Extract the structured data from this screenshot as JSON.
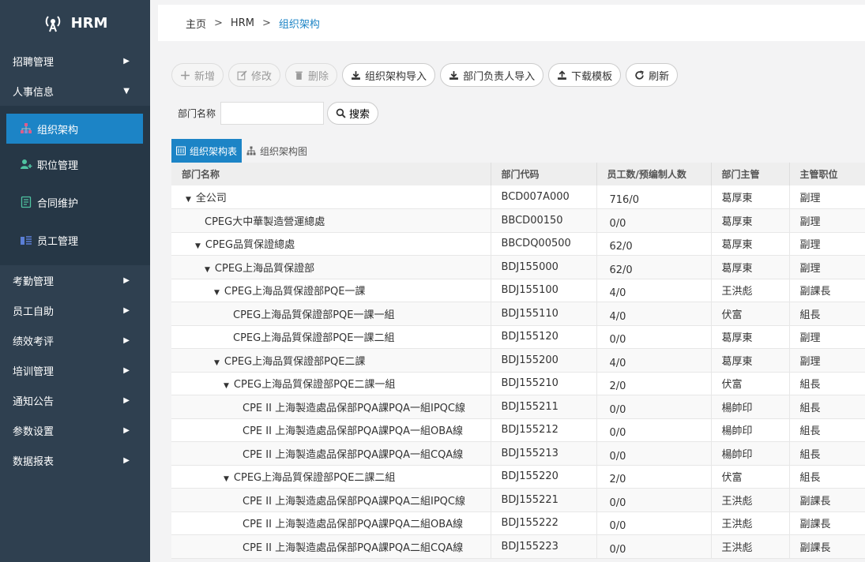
{
  "app": {
    "title": "HRM"
  },
  "sidebar": {
    "menus_top": [
      {
        "label": "招聘管理",
        "arrow": "▶"
      },
      {
        "label": "人事信息",
        "arrow": "▼"
      }
    ],
    "submenu": [
      {
        "label": "组织架构",
        "icon": "org-chart-icon"
      },
      {
        "label": "职位管理",
        "icon": "user-add-icon"
      },
      {
        "label": "合同维护",
        "icon": "document-icon"
      },
      {
        "label": "员工管理",
        "icon": "employee-list-icon"
      }
    ],
    "menus_bottom": [
      {
        "label": "考勤管理",
        "arrow": "▶"
      },
      {
        "label": "员工自助",
        "arrow": "▶"
      },
      {
        "label": "绩效考评",
        "arrow": "▶"
      },
      {
        "label": "培训管理",
        "arrow": "▶"
      },
      {
        "label": "通知公告",
        "arrow": "▶"
      },
      {
        "label": "参数设置",
        "arrow": "▶"
      },
      {
        "label": "数据报表",
        "arrow": "▶"
      }
    ]
  },
  "breadcrumb": {
    "home": "主页",
    "module": "HRM",
    "current": "组织架构",
    "sep": ">"
  },
  "toolbar": {
    "add": "新增",
    "edit": "修改",
    "delete": "删除",
    "import_org": "组织架构导入",
    "import_head": "部门负责人导入",
    "download": "下载模板",
    "refresh": "刷新"
  },
  "search": {
    "label": "部门名称",
    "value": "",
    "button": "搜索"
  },
  "tabs": {
    "table": "组织架构表",
    "chart": "组织架构图"
  },
  "table": {
    "headers": [
      "部门名称",
      "部门代码",
      "员工数/预编制人数",
      "部门主管",
      "主管职位"
    ],
    "rows": [
      {
        "name": "全公司",
        "level": 0,
        "expanded": true,
        "code": "BCD007A000",
        "count": "716/0",
        "manager": "葛厚東",
        "position": "副理"
      },
      {
        "name": "CPEG大中華製造營運總處",
        "level": 1,
        "expanded": false,
        "code": "BBCD00150",
        "count": "0/0",
        "manager": "葛厚東",
        "position": "副理"
      },
      {
        "name": "CPEG品質保證總處",
        "level": 1,
        "expanded": true,
        "code": "BBCDQ00500",
        "count": "62/0",
        "manager": "葛厚東",
        "position": "副理"
      },
      {
        "name": "CPEG上海品質保證部",
        "level": 2,
        "expanded": true,
        "code": "BDJ155000",
        "count": "62/0",
        "manager": "葛厚東",
        "position": "副理"
      },
      {
        "name": "CPEG上海品質保證部PQE一課",
        "level": 3,
        "expanded": true,
        "code": "BDJ155100",
        "count": "4/0",
        "manager": "王洪彪",
        "position": "副課長"
      },
      {
        "name": "CPEG上海品質保證部PQE一課一組",
        "level": 4,
        "expanded": false,
        "code": "BDJ155110",
        "count": "4/0",
        "manager": "伏富",
        "position": "組長"
      },
      {
        "name": "CPEG上海品質保證部PQE一課二組",
        "level": 4,
        "expanded": false,
        "code": "BDJ155120",
        "count": "0/0",
        "manager": "葛厚東",
        "position": "副理"
      },
      {
        "name": "CPEG上海品質保證部PQE二課",
        "level": 3,
        "expanded": true,
        "code": "BDJ155200",
        "count": "4/0",
        "manager": "葛厚東",
        "position": "副理"
      },
      {
        "name": "CPEG上海品質保證部PQE二課一組",
        "level": 4,
        "expanded": true,
        "code": "BDJ155210",
        "count": "2/0",
        "manager": "伏富",
        "position": "組長"
      },
      {
        "name": "CPE II 上海製造處品保部PQA課PQA一組IPQC線",
        "level": 5,
        "expanded": false,
        "code": "BDJ155211",
        "count": "0/0",
        "manager": "楊帥印",
        "position": "組長"
      },
      {
        "name": "CPE II 上海製造處品保部PQA課PQA一組OBA線",
        "level": 5,
        "expanded": false,
        "code": "BDJ155212",
        "count": "0/0",
        "manager": "楊帥印",
        "position": "組長"
      },
      {
        "name": "CPE II 上海製造處品保部PQA課PQA一組CQA線",
        "level": 5,
        "expanded": false,
        "code": "BDJ155213",
        "count": "0/0",
        "manager": "楊帥印",
        "position": "組長"
      },
      {
        "name": "CPEG上海品質保證部PQE二課二組",
        "level": 4,
        "expanded": true,
        "code": "BDJ155220",
        "count": "2/0",
        "manager": "伏富",
        "position": "組長"
      },
      {
        "name": "CPE II 上海製造處品保部PQA課PQA二組IPQC線",
        "level": 5,
        "expanded": false,
        "code": "BDJ155221",
        "count": "0/0",
        "manager": "王洪彪",
        "position": "副課長"
      },
      {
        "name": "CPE II 上海製造處品保部PQA課PQA二組OBA線",
        "level": 5,
        "expanded": false,
        "code": "BDJ155222",
        "count": "0/0",
        "manager": "王洪彪",
        "position": "副課長"
      },
      {
        "name": "CPE II 上海製造處品保部PQA課PQA二組CQA線",
        "level": 5,
        "expanded": false,
        "code": "BDJ155223",
        "count": "0/0",
        "manager": "王洪彪",
        "position": "副課長"
      }
    ]
  },
  "colors": {
    "sidebar": "#2f4050",
    "accent": "#1c84c6"
  }
}
